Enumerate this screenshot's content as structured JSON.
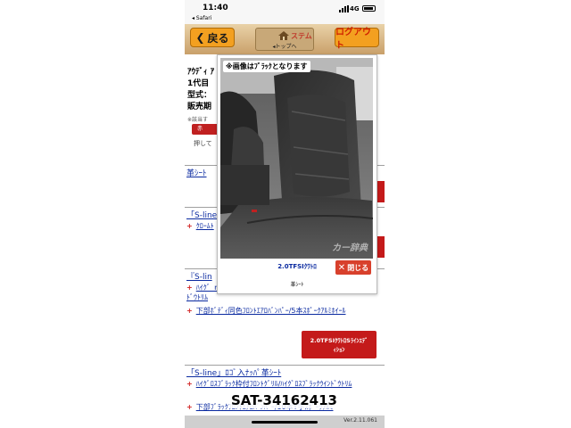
{
  "status_bar": {
    "time": "11:40",
    "back_app": "◂ Safari",
    "network": "4G"
  },
  "header": {
    "back_label": "戻る",
    "top_logo": "ステム",
    "top_label": "◂トップへ",
    "logout_label": "ログアウト"
  },
  "background": {
    "spec_lines": [
      "ｱｳﾃﾞｨ ｱ",
      "1代目",
      "型式：",
      "販売期"
    ],
    "note": "※該当す",
    "red_pill": "赤",
    "sub_note": "押して",
    "seat_link": "革ｼｰﾄ",
    "sline_link_1": "「S-line",
    "chrome_line": "ｸﾛｰﾑﾄ",
    "sline_link_2": "『S-lin",
    "feature_1": "ﾊｲｸﾞ ｒ",
    "feature_1b": "ﾄﾞｳﾄﾘﾑ",
    "feature_2": "下部ﾎﾞﾃﾞｨ同色ﾌﾛﾝﾄｴｱﾛﾊﾞﾝﾊﾟｰ/5本ｽﾎﾟｰｸｱﾙﾐﾎｲｰﾙ",
    "grade_button_line1": "2.0TFSIｸﾜﾄﾛSﾗｲﾝｴﾃﾞ",
    "grade_button_line2": "ｨｼｮﾝ",
    "sline_link_3": "「S-line」ﾛｺﾞ入ﾅｯﾊﾟ革ｼｰﾄ",
    "feature_3": "ﾊｲｸﾞﾛｽﾌﾞﾗｯｸ枠付ﾌﾛﾝﾄｸﾞﾘﾙ/ﾊｲｸﾞﾛｽﾌﾞﾗｯｸｳｲﾝﾄﾞｳﾄﾘﾑ",
    "feature_4": "下部ﾌﾞﾗｯｸﾌﾛﾝﾄｴｱﾛﾊﾞﾝﾊﾟｰ/10本Y字ｽﾎﾟｰｸｱﾙﾐ"
  },
  "modal": {
    "photo_label": "※画像はﾌﾞﾗｯｸとなります",
    "watermark": "カー辞典",
    "grade": "2.0TFSIｸﾜﾄﾛ",
    "close_label": "閉じる",
    "seat_type": "革ｼｰﾄ"
  },
  "stock_number": "SAT-34162413",
  "version": "Ver.2.11.061",
  "colors": {
    "accent_orange": "#f3a020",
    "link_blue": "#0a2aa0",
    "button_red": "#c41a1a",
    "close_red": "#d8402c"
  }
}
